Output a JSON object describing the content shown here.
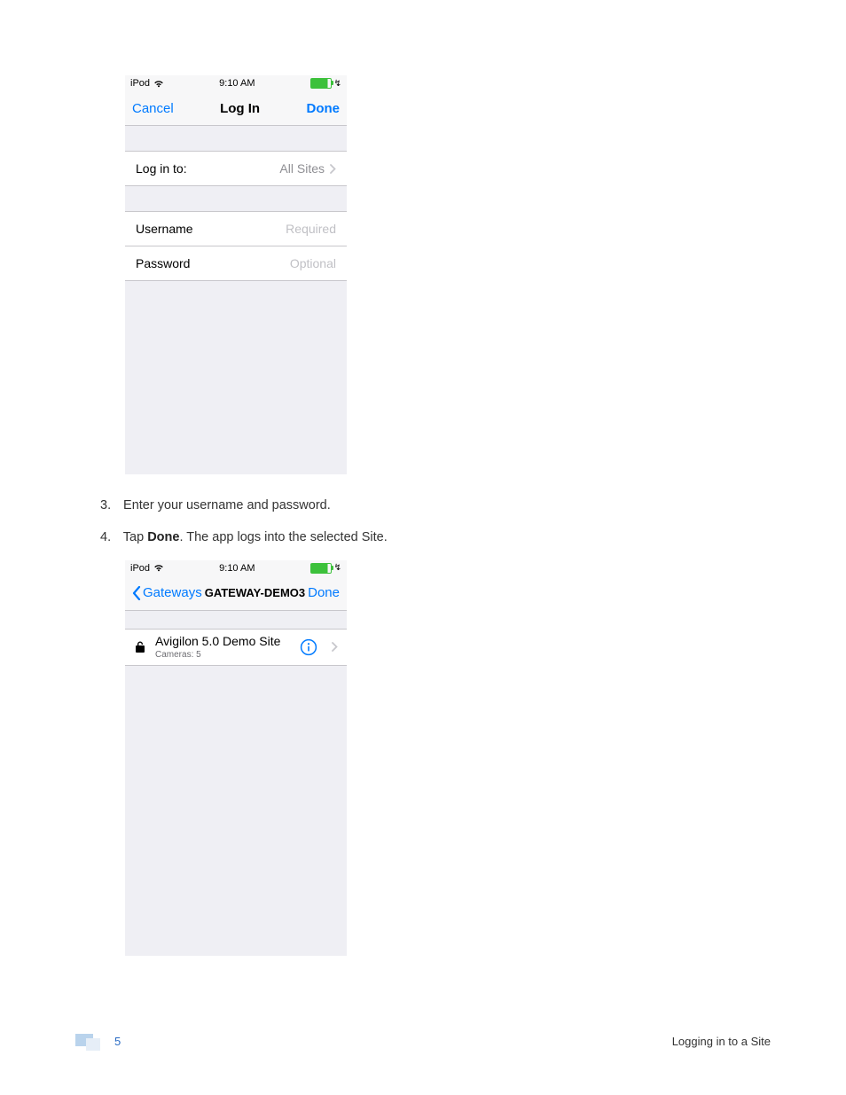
{
  "screenshot1": {
    "status": {
      "device": "iPod",
      "time": "9:10 AM"
    },
    "nav": {
      "cancel": "Cancel",
      "title": "Log In",
      "done": "Done"
    },
    "rows": {
      "login_to_label": "Log in to:",
      "login_to_value": "All Sites",
      "username_label": "Username",
      "username_placeholder": "Required",
      "password_label": "Password",
      "password_placeholder": "Optional"
    }
  },
  "steps": {
    "s3_num": "3.",
    "s3_text": "Enter your username and password.",
    "s4_num": "4.",
    "s4_prefix": "Tap ",
    "s4_bold": "Done",
    "s4_suffix": ". The app logs into the selected Site."
  },
  "screenshot2": {
    "status": {
      "device": "iPod",
      "time": "9:10 AM"
    },
    "nav": {
      "back": "Gateways",
      "title": "GATEWAY-DEMO3",
      "done": "Done"
    },
    "site": {
      "name": "Avigilon 5.0 Demo Site",
      "sub": "Cameras: 5"
    }
  },
  "footer": {
    "page": "5",
    "section": "Logging in to a Site"
  },
  "colors": {
    "ios_blue": "#007aff"
  }
}
